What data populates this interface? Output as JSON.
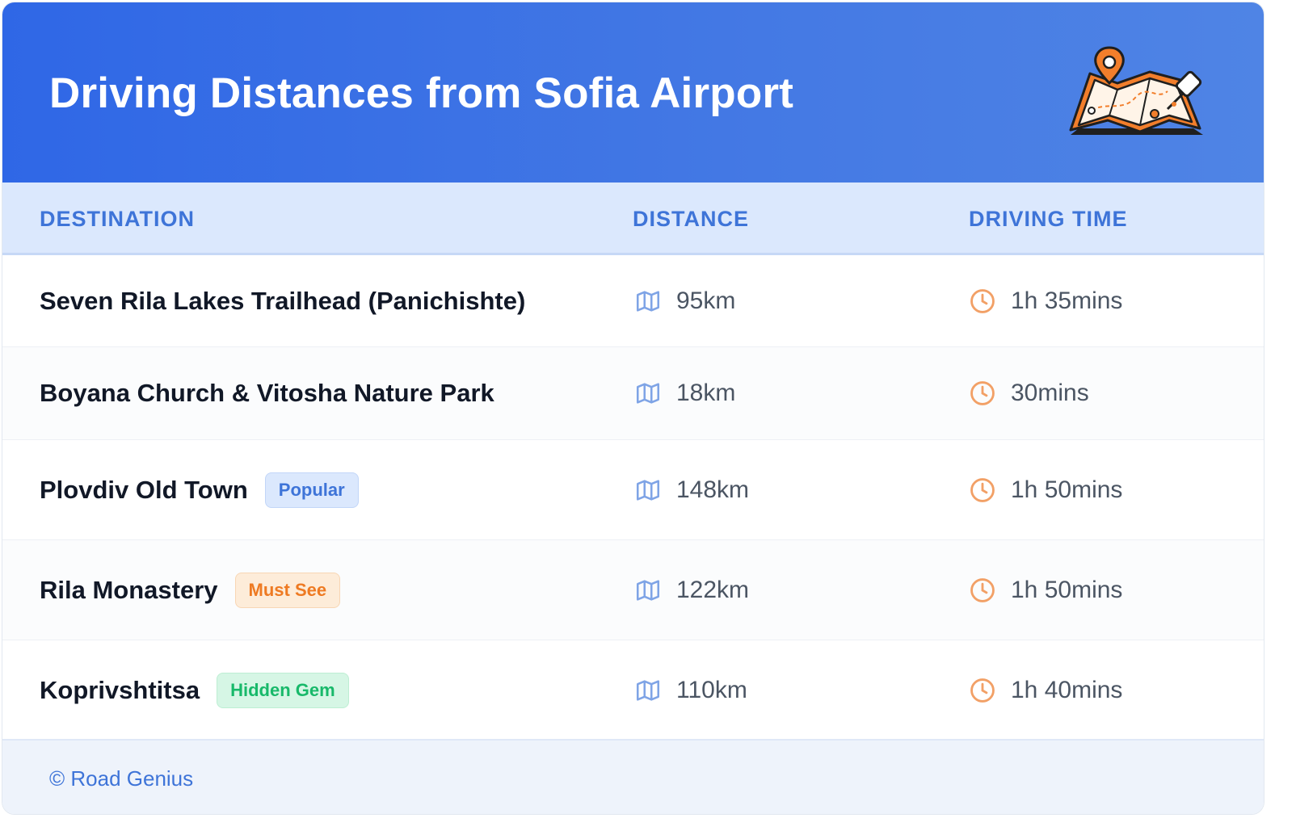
{
  "header": {
    "title": "Driving Distances from Sofia Airport"
  },
  "colors": {
    "accent": "#2f67e6",
    "orange": "#ee7a22",
    "green": "#18b96a"
  },
  "table": {
    "columns": [
      "DESTINATION",
      "DISTANCE",
      "DRIVING TIME"
    ],
    "rows": [
      {
        "destination": "Seven Rila Lakes Trailhead (Panichishte)",
        "badge": "",
        "distance": "95km",
        "time": "1h 35mins"
      },
      {
        "destination": "Boyana Church & Vitosha Nature Park",
        "badge": "",
        "distance": "18km",
        "time": "30mins"
      },
      {
        "destination": "Plovdiv Old Town",
        "badge": "Popular",
        "distance": "148km",
        "time": "1h 50mins"
      },
      {
        "destination": "Rila Monastery",
        "badge": "Must See",
        "distance": "122km",
        "time": "1h 50mins"
      },
      {
        "destination": "Koprivshtitsa",
        "badge": "Hidden Gem",
        "distance": "110km",
        "time": "1h 40mins"
      }
    ]
  },
  "icons": {
    "distance": "map-icon",
    "time": "clock-icon",
    "hero": "folded-map-pin-illustration"
  },
  "footer": {
    "copyright": "© Road Genius"
  }
}
